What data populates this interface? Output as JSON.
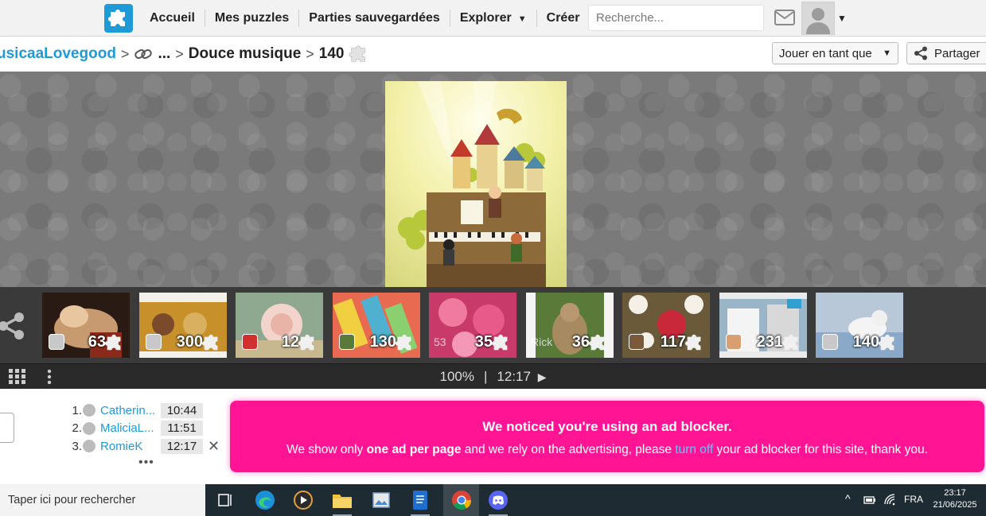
{
  "nav": {
    "items": [
      {
        "label": "Accueil"
      },
      {
        "label": "Mes puzzles"
      },
      {
        "label": "Parties sauvegardées"
      },
      {
        "label": "Explorer"
      },
      {
        "label": "Créer"
      }
    ],
    "search_placeholder": "Recherche..."
  },
  "breadcrumb": {
    "user": "usicaaLovegood",
    "ellipsis": "...",
    "title": "Douce musique",
    "pieces": "140"
  },
  "actions": {
    "play_as": "Jouer en tant que",
    "share": "Partager"
  },
  "thumbs": [
    {
      "count": "63",
      "name": ""
    },
    {
      "count": "300",
      "name": ""
    },
    {
      "count": "12",
      "name": ""
    },
    {
      "count": "130",
      "name": ""
    },
    {
      "count": "35",
      "name": "53"
    },
    {
      "count": "36",
      "name": "Rick"
    },
    {
      "count": "117",
      "name": ""
    },
    {
      "count": "231",
      "name": ""
    },
    {
      "count": "140",
      "name": ""
    }
  ],
  "controls": {
    "zoom": "100%",
    "separator": "|",
    "timer": "12:17"
  },
  "scores": [
    {
      "rank": "1.",
      "name": "Catherin...",
      "time": "10:44"
    },
    {
      "rank": "2.",
      "name": "MaliciaL...",
      "time": "11:51"
    },
    {
      "rank": "3.",
      "name": "RomieK",
      "time": "12:17"
    }
  ],
  "scores_more": "•••",
  "adblock": {
    "title": "We noticed you're using an ad blocker.",
    "text_before": "We show only ",
    "text_bold": "one ad per page",
    "text_middle": " and we rely on the advertising, please ",
    "link": "turn off",
    "text_after": " your ad blocker for this site, thank you."
  },
  "taskbar": {
    "search_placeholder": "Taper ici pour rechercher",
    "lang": "FRA",
    "time": "23:17",
    "date": "21/06/2025"
  },
  "colors": {
    "accent": "#1e9ad6",
    "ad_bg": "#ff1493"
  }
}
